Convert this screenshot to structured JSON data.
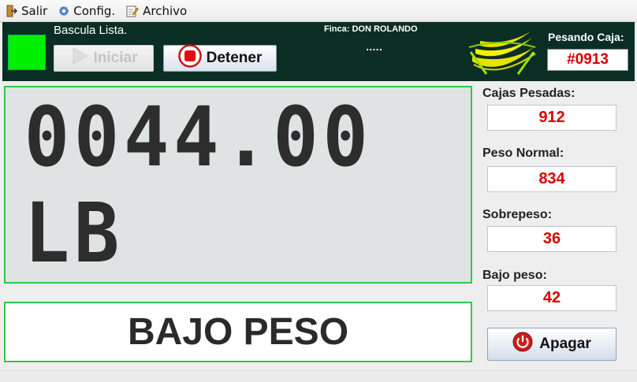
{
  "menu": {
    "salir": "Salir",
    "config": "Config.",
    "archivo": "Archivo"
  },
  "header": {
    "status_text": "Bascula Lista.",
    "status_color": "#00f000",
    "iniciar_label": "Iniciar",
    "detener_label": "Detener",
    "finca": "Finca: DON ROLANDO",
    "dots": ".....",
    "pesando_label": "Pesando Caja:",
    "caja_number": "#0913"
  },
  "display": {
    "weight": "0044.00 LB",
    "status": "BAJO PESO"
  },
  "stats": {
    "cajas_label": "Cajas Pesadas:",
    "cajas_value": "912",
    "normal_label": "Peso Normal:",
    "normal_value": "834",
    "sobrepeso_label": "Sobrepeso:",
    "sobrepeso_value": "36",
    "bajo_label": "Bajo peso:",
    "bajo_value": "42"
  },
  "apagar_label": "Apagar",
  "colors": {
    "header_bg": "#0a2e24",
    "value_red": "#d40000",
    "panel_border": "#2dc94a"
  }
}
